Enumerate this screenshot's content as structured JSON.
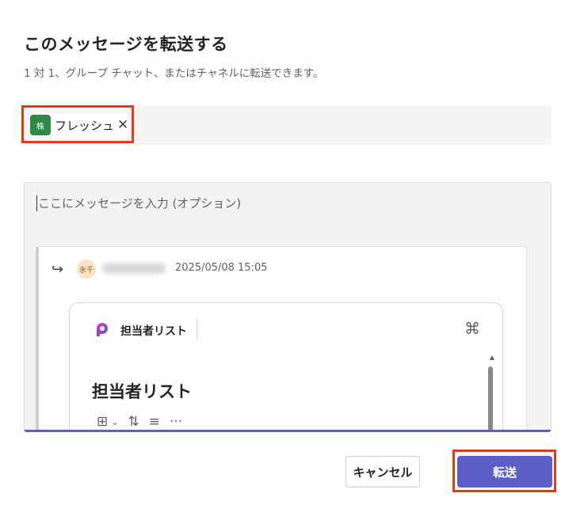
{
  "dialog": {
    "title": "このメッセージを転送する",
    "subtitle": "1 対 1、グループ チャット、またはチャネルに転送できます。"
  },
  "recipients": [
    {
      "avatar_text": "株",
      "name": "フレッシュ",
      "avatar_color": "#2d8a47"
    }
  ],
  "message_input": {
    "placeholder": "ここにメッセージを入力 (オプション)"
  },
  "forwarded": {
    "avatar_text": "氷千",
    "timestamp": "2025/05/08 15:05",
    "card": {
      "app_name": "担当者リスト",
      "title": "担当者リスト"
    }
  },
  "buttons": {
    "cancel": "キャンセル",
    "forward": "転送"
  },
  "colors": {
    "accent": "#5b5fc7",
    "highlight": "#e53a19"
  }
}
